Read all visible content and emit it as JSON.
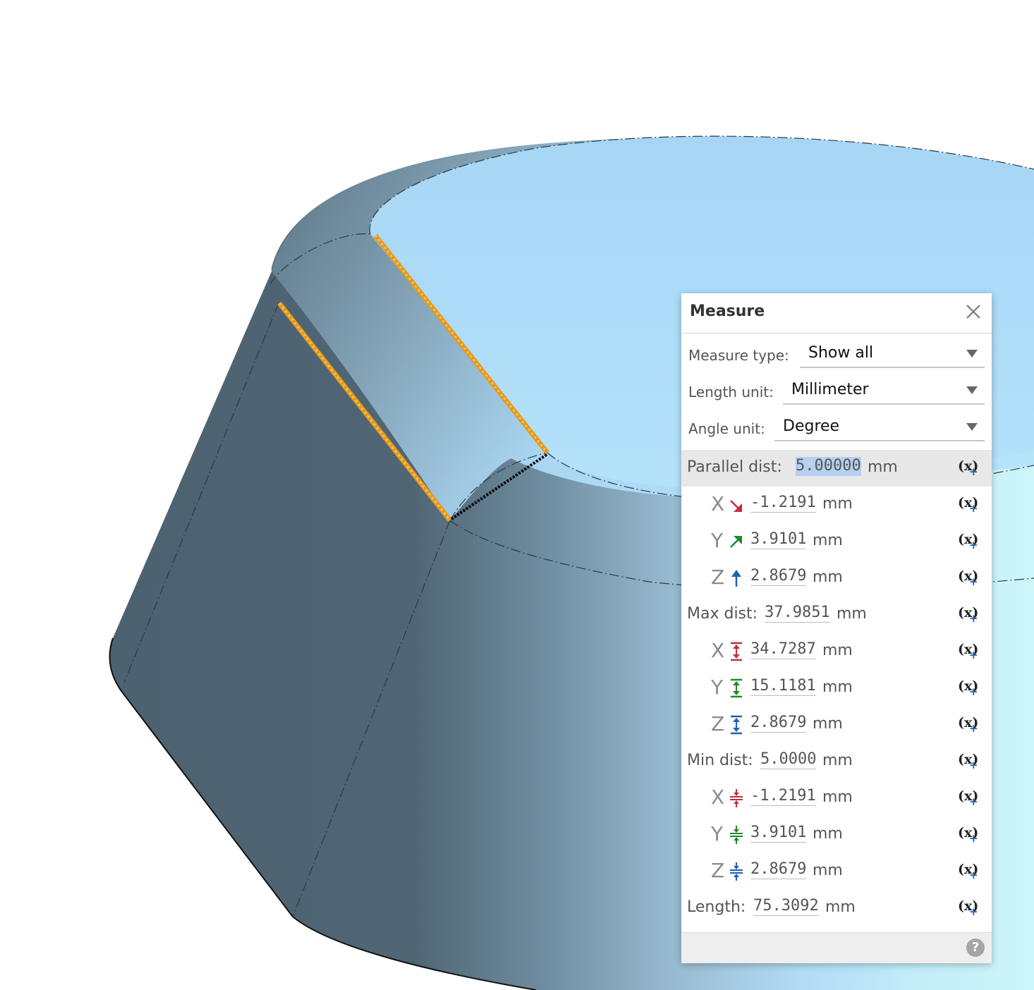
{
  "panel": {
    "title": "Measure",
    "measure_type": {
      "label": "Measure type:",
      "value": "Show all"
    },
    "length_unit": {
      "label": "Length unit:",
      "value": "Millimeter"
    },
    "angle_unit": {
      "label": "Angle unit:",
      "value": "Degree"
    },
    "variable_button_label": "(x)",
    "variable_button_plus": "+",
    "help_label": "?",
    "parallel": {
      "label": "Parallel dist:",
      "value": "5.00000",
      "unit": "mm",
      "x": {
        "axis": "X",
        "value": "-1.2191",
        "unit": "mm"
      },
      "y": {
        "axis": "Y",
        "value": "3.9101",
        "unit": "mm"
      },
      "z": {
        "axis": "Z",
        "value": "2.8679",
        "unit": "mm"
      }
    },
    "max": {
      "label": "Max dist:",
      "value": "37.9851",
      "unit": "mm",
      "x": {
        "axis": "X",
        "value": "34.7287",
        "unit": "mm"
      },
      "y": {
        "axis": "Y",
        "value": "15.1181",
        "unit": "mm"
      },
      "z": {
        "axis": "Z",
        "value": "2.8679",
        "unit": "mm"
      }
    },
    "min": {
      "label": "Min dist:",
      "value": "5.0000",
      "unit": "mm",
      "x": {
        "axis": "X",
        "value": "-1.2191",
        "unit": "mm"
      },
      "y": {
        "axis": "Y",
        "value": "3.9101",
        "unit": "mm"
      },
      "z": {
        "axis": "Z",
        "value": "2.8679",
        "unit": "mm"
      }
    },
    "length": {
      "label": "Length:",
      "value": "75.3092",
      "unit": "mm"
    }
  },
  "colors": {
    "x_axis": "#c0303a",
    "y_axis": "#1e8a2a",
    "z_axis": "#1f5fb5",
    "selected_edge": "#f0a820",
    "model_dark": "#4e6473",
    "model_light": "#a8d8f6"
  }
}
